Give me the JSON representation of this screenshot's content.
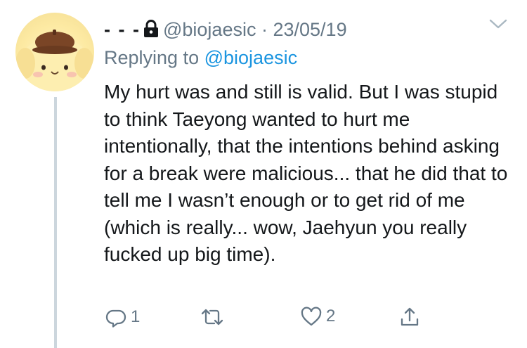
{
  "tweet": {
    "name": "- - -",
    "handle": "@biojaesic",
    "separator": "·",
    "date": "23/05/19",
    "replying_prefix": "Replying to",
    "replying_to": "@biojaesic",
    "text": "My hurt was and still is valid. But I was stupid to think Taeyong wanted to hurt me intentionally, that the intentions behind asking for a break were malicious... that he did that to tell me I wasn’t enough or to get rid of me (which is really... wow, Jaehyun you really fucked up big time).",
    "reply_count": "1",
    "retweet_count": "",
    "like_count": "2"
  },
  "icons": {
    "lock": "lock-icon",
    "more": "chevron-down-icon",
    "reply": "reply-icon",
    "retweet": "retweet-icon",
    "like": "heart-icon",
    "share": "share-icon"
  },
  "colors": {
    "text": "#14171a",
    "muted": "#657786",
    "link": "#1b95e0",
    "thread_line": "#ccd6dd",
    "background": "#ffffff"
  }
}
